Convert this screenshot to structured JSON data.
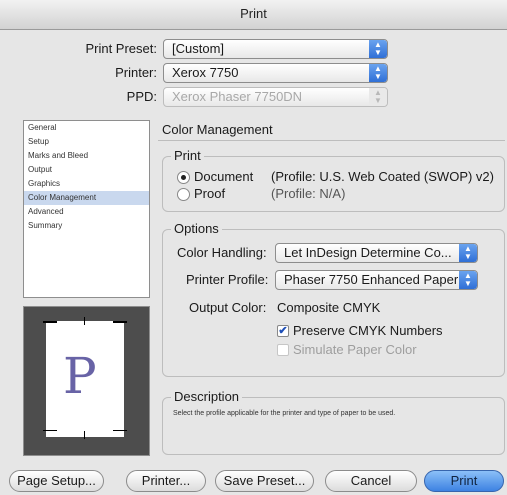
{
  "window": {
    "title": "Print"
  },
  "top": {
    "preset_label": "Print Preset:",
    "preset_value": "[Custom]",
    "printer_label": "Printer:",
    "printer_value": "Xerox 7750",
    "ppd_label": "PPD:",
    "ppd_value": "Xerox Phaser 7750DN"
  },
  "sidebar": {
    "items": [
      {
        "label": "General"
      },
      {
        "label": "Setup"
      },
      {
        "label": "Marks and Bleed"
      },
      {
        "label": "Output"
      },
      {
        "label": "Graphics"
      },
      {
        "label": "Color Management"
      },
      {
        "label": "Advanced"
      },
      {
        "label": "Summary"
      }
    ],
    "selected": "Color Management"
  },
  "preview": {
    "letter": "P"
  },
  "color_management": {
    "heading": "Color Management",
    "print_group": {
      "title": "Print",
      "document_label": "Document",
      "document_profile": "(Profile: U.S. Web Coated (SWOP) v2)",
      "proof_label": "Proof",
      "proof_profile": "(Profile: N/A)",
      "selected": "Document"
    },
    "options_group": {
      "title": "Options",
      "color_handling_label": "Color Handling:",
      "color_handling_value": "Let InDesign Determine Co...",
      "printer_profile_label": "Printer Profile:",
      "printer_profile_value": "Phaser 7750 Enhanced Paper",
      "output_color_label": "Output Color:",
      "output_color_value": "Composite CMYK",
      "preserve_cmyk_label": "Preserve CMYK Numbers",
      "preserve_cmyk_checked": true,
      "simulate_paper_label": "Simulate Paper Color",
      "simulate_paper_checked": false
    },
    "description_group": {
      "title": "Description",
      "text": "Select the profile applicable for the printer and type of paper to be used."
    }
  },
  "buttons": {
    "page_setup": "Page Setup...",
    "printer": "Printer...",
    "save_preset": "Save Preset...",
    "cancel": "Cancel",
    "print": "Print"
  },
  "icons": {
    "popup_arrows": "up-down-arrows-icon",
    "checkmark": "checkmark-icon"
  },
  "colors": {
    "accent": "#3d82e2",
    "selection": "#c9d8ee",
    "preview_letter": "#6863a6"
  }
}
